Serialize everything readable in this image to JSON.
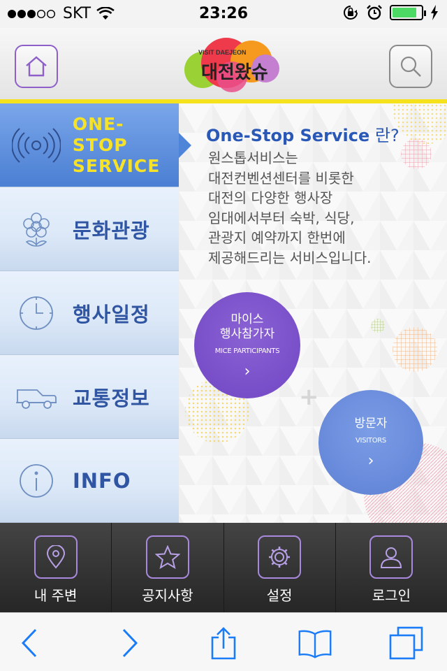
{
  "status_bar": {
    "carrier": "SKT",
    "time": "23:26",
    "battery_level": 0.85,
    "signal_bars_filled": 3,
    "signal_bars_total": 5
  },
  "header": {
    "logo_text_small": "VISIT DAEJEON",
    "logo_text_main": "대전왔슈",
    "home_icon": "home-icon",
    "search_icon": "search-icon"
  },
  "sidebar": {
    "items": [
      {
        "label_line1": "ONE-STOP",
        "label_line2": "SERVICE",
        "icon": "broadcast-icon",
        "active": true
      },
      {
        "label": "문화관광",
        "icon": "flower-icon"
      },
      {
        "label": "행사일정",
        "icon": "clock-icon"
      },
      {
        "label": "교통정보",
        "icon": "car-icon"
      },
      {
        "label": "INFO",
        "icon": "info-icon"
      }
    ]
  },
  "main": {
    "title": "One-Stop Service",
    "title_suffix": " 란?",
    "description_lines": [
      "원스톱서비스는",
      "대전컨벤션센터를 비롯한",
      "대전의 다양한 행사장",
      "임대에서부터 숙박, 식당,",
      "관광지 예약까지 한번에",
      "제공해드리는 서비스입니다."
    ],
    "mice": {
      "line1": "마이스",
      "line2": "행사참가자",
      "en": "MICE PARTICIPANTS",
      "chevron": "›"
    },
    "visitors": {
      "line1": "방문자",
      "en": "VISITORS",
      "chevron": "›"
    },
    "plus": "+",
    "colors": {
      "accent_blue": "#2a58b7",
      "mice_purple": "#7146c4",
      "visitor_blue": "#5e80d4",
      "highlight_yellow": "#f6e226"
    }
  },
  "tabbar": {
    "items": [
      {
        "label": "내 주변",
        "icon": "location-pin-icon"
      },
      {
        "label": "공지사항",
        "icon": "star-icon"
      },
      {
        "label": "설정",
        "icon": "gear-icon"
      },
      {
        "label": "로그인",
        "icon": "user-icon"
      }
    ]
  },
  "browser_toolbar": {
    "icons": [
      "back-icon",
      "forward-icon",
      "share-icon",
      "bookmarks-icon",
      "tabs-icon"
    ]
  }
}
